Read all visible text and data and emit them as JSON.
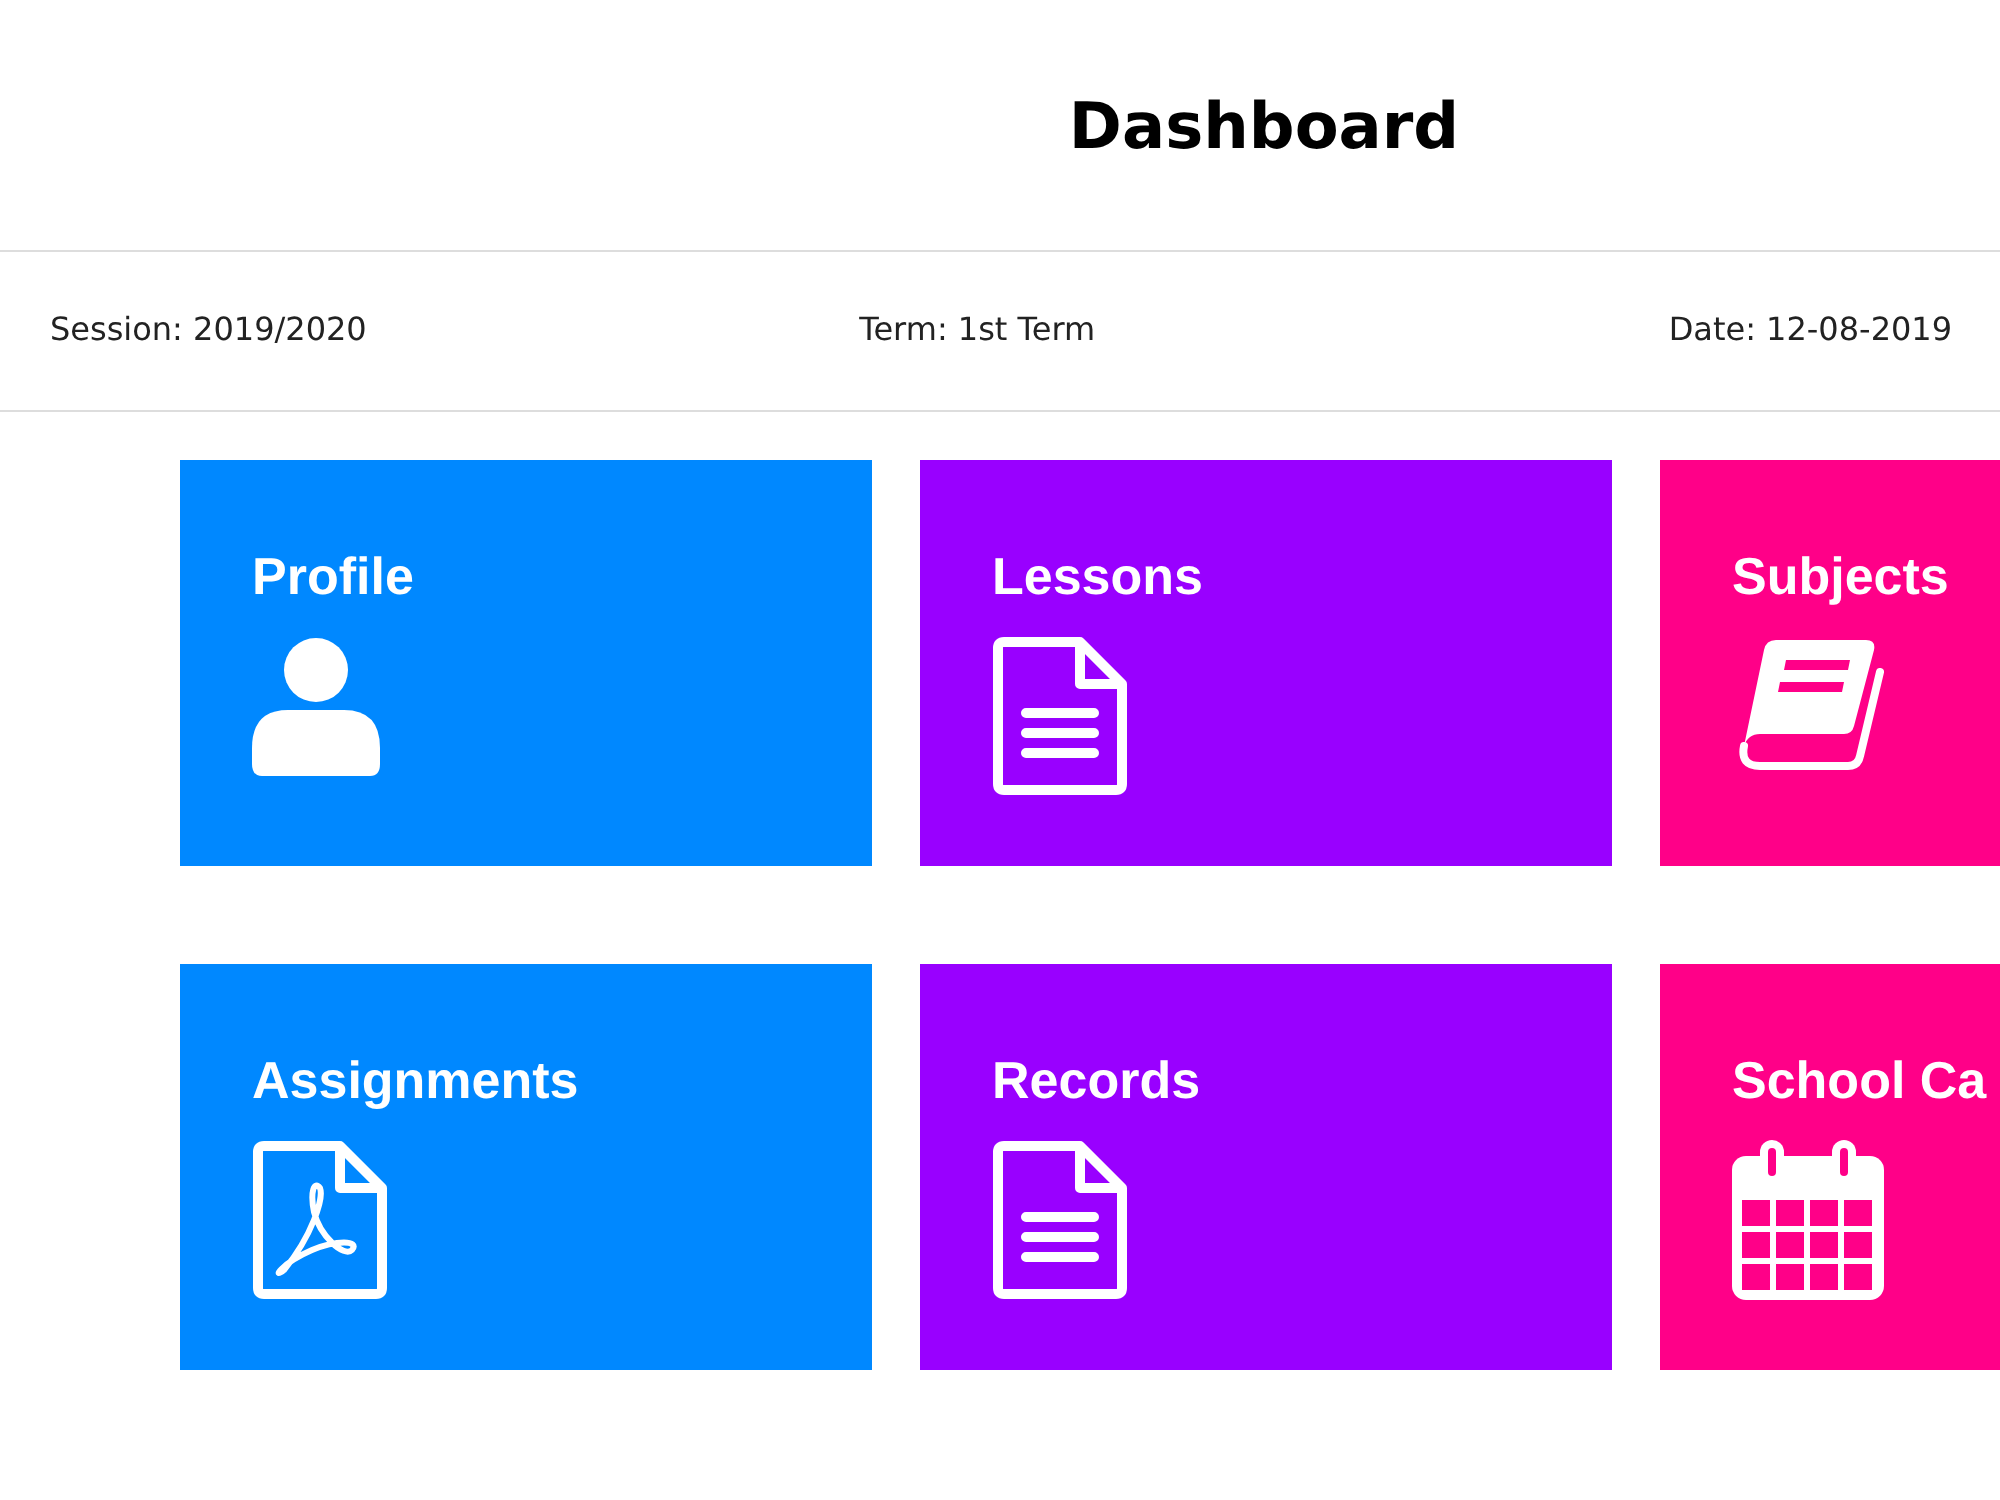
{
  "page": {
    "title": "Dashboard"
  },
  "info_bar": [
    "Session: 2019/2020",
    "Term: 1st Term",
    "Date: 12-08-2019"
  ],
  "tiles": [
    {
      "title": "Profile",
      "color": "#0088ff"
    },
    {
      "title": "Lessons",
      "color": "#9900ff"
    },
    {
      "title": "Subjects",
      "color": "#ff0088"
    },
    {
      "title": "Assignments",
      "color": "#0088ff"
    },
    {
      "title": "Records",
      "color": "#9900ff"
    },
    {
      "title": "School Ca",
      "color": "#ff0088"
    }
  ]
}
